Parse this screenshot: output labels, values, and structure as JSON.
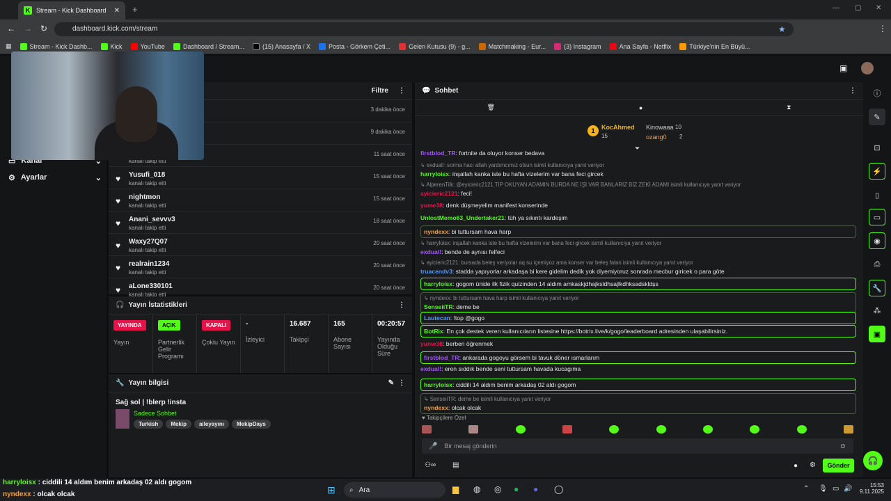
{
  "browser": {
    "tab_title": "Stream - Kick Dashboard",
    "url": "dashboard.kick.com/stream",
    "bookmarks": [
      "Stream - Kick Dashb...",
      "Kick",
      "YouTube",
      "Dashboard / Stream...",
      "(15) Anasayfa / X",
      "Posta - Görkem Çeti...",
      "Gelen Kutusu (9) - g...",
      "Matchmaking - Eur...",
      "(3) Instagram",
      "Ana Sayfa - Netflix",
      "Türkiye'nin En Büyü..."
    ]
  },
  "nav": {
    "items": [
      "Kanal",
      "Ayarlar"
    ]
  },
  "follows": {
    "title": "Filtre",
    "sub": "kanalı takip etti",
    "rows": [
      {
        "name": "",
        "time": "3 dakika önce"
      },
      {
        "name": "",
        "time": "9 dakika önce"
      },
      {
        "name": "",
        "time": "11 saat önce"
      },
      {
        "name": "Yusufi_018",
        "time": "15 saat önce"
      },
      {
        "name": "nightmon",
        "time": "15 saat önce"
      },
      {
        "name": "Anani_sevvv3",
        "time": "18 saat önce"
      },
      {
        "name": "Waxy27Q07",
        "time": "20 saat önce"
      },
      {
        "name": "realrain1234",
        "time": "20 saat önce"
      },
      {
        "name": "aLone330101",
        "time": "20 saat önce"
      }
    ]
  },
  "stats": {
    "title": "Yayın İstatistikleri",
    "cols": [
      {
        "pill": "YAYINDA",
        "label": "Yayın"
      },
      {
        "pill": "AÇIK",
        "label": "Partnerlik Gelir Programı"
      },
      {
        "pill": "KAPALI",
        "label": "Çoklu Yayın"
      },
      {
        "value": "-",
        "label": "İzleyici"
      },
      {
        "value": "16.687",
        "label": "Takipçi"
      },
      {
        "value": "165",
        "label": "Abone Sayısı"
      },
      {
        "value": "00:20:57",
        "label": "Yayında Olduğu Süre"
      }
    ]
  },
  "info": {
    "title": "Yayın bilgisi",
    "stream_title": "Sağ sol | !blerp !insta",
    "category": "Sadece Sohbet",
    "tags": [
      "Turkish",
      "Mekip",
      "aileyayını",
      "MekipDays"
    ]
  },
  "chat": {
    "title": "Sohbet",
    "placeholder": "Bir mesaj gönderin",
    "send": "Gönder",
    "followers_only": "Takipçilere Özel",
    "leaders": {
      "first": "KocAhmed",
      "first_count": "15",
      "second": "Kinowaaa",
      "second_count": "10",
      "third": "ozang0",
      "third_count": "2"
    },
    "messages": [
      {
        "user": "firstblod_TR",
        "text": "fortnite da oluyor konser bedava",
        "reply": ""
      },
      {
        "user": "harryloisx",
        "text": "inşallah kanka iste bu hafta vizelerim var bana feci gircek",
        "reply": "exdual!: sorma hacı allah yardımcımız olsun isimli kullanıcıya yanıt veriyor"
      },
      {
        "user": "ayicieric2121",
        "text": "feci!",
        "reply": "AlperenTilk: @eyicieric2121 TIP OKUYAN ADAMIN BURDA NE İŞİ VAR BANLARIZ BİZ ZEKİ ADAMI isimli kullanıcıya yanıt veriyor"
      },
      {
        "user": "yume38",
        "text": "denk düşmeyelim manifest konserinde",
        "reply": ""
      },
      {
        "user": "UnlostMemo63_Undertaker21",
        "text": "tüh ya sıkıntı kardeşim",
        "reply": ""
      },
      {
        "user": "nyndexx",
        "text": "bi tuttursam hava harp",
        "reply": ""
      },
      {
        "user": "exdual!",
        "text": "bende de aynısı felfeci",
        "reply": "harryloisx: inşallah kanka iste bu hafta vizelerim var bana feci gircek isimli kullanıcıya yanıt veriyor"
      },
      {
        "user": "truacendv3",
        "text": "stadda yapıyorlar arkadaşa bi kere gidelim dedik yok diyemiyoruz sonradа mecbur giricek o para göte",
        "reply": "ayicieric2121: bursada beleş veriyolar aq su içemiyoz ama konser var beleş falan isimli kullanıcıya yanıt veriyor"
      },
      {
        "user": "harryloisx",
        "text": "gogom ünide ilk fizik quizinden 14 aldım amkaskjdhajksldhsajlkdhksadskldşs",
        "reply": ""
      },
      {
        "user": "SenseiiTR",
        "text": "deme be",
        "reply": "nyndexx: bi tuttursam hava harp isimli kullanıcıya yanıt veriyor"
      },
      {
        "user": "Lautecan",
        "text": "!top @gogo",
        "reply": ""
      },
      {
        "user": "BotRix",
        "text": "En çok destek veren kullanıcıların listesine https://botrix.live/k/gogo/leaderboard adresinden ulaşabilirsiniz.",
        "reply": ""
      },
      {
        "user": "yume38",
        "text": "berberi öğrenmek",
        "reply": ""
      },
      {
        "user": "firstblod_TR",
        "text": "ankarada gogoyu görsem bi tavuk döner ısmarlarım",
        "reply": ""
      },
      {
        "user": "exdual!",
        "text": "eren sıddık bende seni tuttursam havada kucagıma",
        "reply": ""
      },
      {
        "user": "harryloisx",
        "text": "ciddili 14 aldım benim arkadaş 02 aldı gogom",
        "reply": ""
      },
      {
        "user": "nyndexx",
        "text": "olcak olcak",
        "reply": "SenseiiTR: deme be isimli kullanıcıya yanıt veriyor"
      }
    ]
  },
  "overlay": {
    "line1_user": "harryloisx",
    "line1_text": "ciddili 14 aldım benim arkadaş 02 aldı gogom",
    "line2_user": "nyndexx",
    "line2_text": "olcak olcak"
  },
  "taskbar": {
    "search": "Ara",
    "time": "15:53",
    "date": "9.11.2025"
  },
  "colors": {
    "kick_green": "#53fc18",
    "live_red": "#e8124b"
  }
}
